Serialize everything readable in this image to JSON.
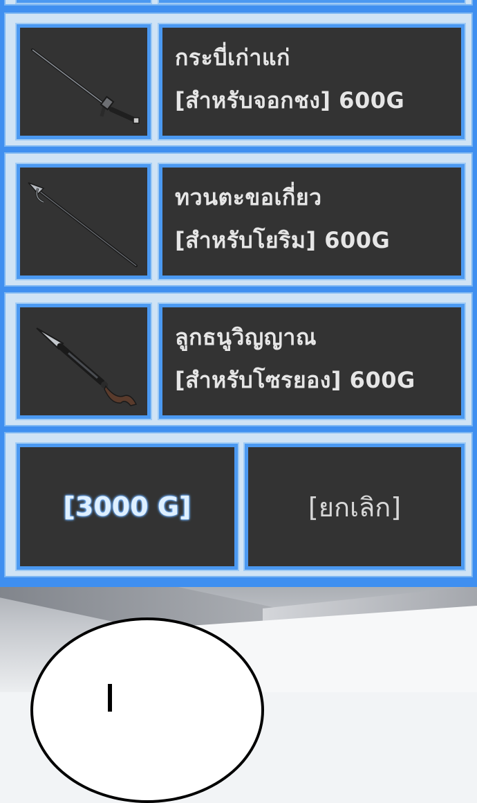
{
  "shop": {
    "items": [
      {
        "name": "กระบี่เก่าแก่",
        "price": "[สำหรับจอกชง] 600G",
        "icon": "sword-icon"
      },
      {
        "name": "ทวนตะขอเกี่ยว",
        "price": "[สำหรับโยริม] 600G",
        "icon": "hook-spear-icon"
      },
      {
        "name": "ลูกธนูวิญญาณ",
        "price": "[สำหรับโซรยอง] 600G",
        "icon": "spirit-arrow-icon"
      }
    ],
    "total_label": "[3000 G]",
    "cancel_label": "[ยกเลิก]"
  },
  "colors": {
    "panel_blue": "#3f8ff0",
    "cell_dark": "#333333",
    "text_light": "#e6e6e6"
  }
}
